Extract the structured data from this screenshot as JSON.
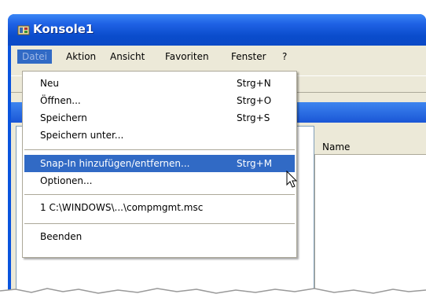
{
  "window": {
    "title": "Konsole1"
  },
  "menubar": {
    "items": [
      "Datei",
      "Aktion",
      "Ansicht",
      "Favoriten",
      "Fenster",
      "?"
    ]
  },
  "list_header": {
    "column": "Name"
  },
  "file_menu": {
    "group1": [
      {
        "label": "Neu",
        "shortcut": "Strg+N"
      },
      {
        "label": "Öffnen...",
        "shortcut": "Strg+O"
      },
      {
        "label": "Speichern",
        "shortcut": "Strg+S"
      },
      {
        "label": "Speichern unter...",
        "shortcut": ""
      }
    ],
    "group2": [
      {
        "label": "Snap-In hinzufügen/entfernen...",
        "shortcut": "Strg+M"
      },
      {
        "label": "Optionen...",
        "shortcut": ""
      }
    ],
    "recent": {
      "label": "1 C:\\WINDOWS\\...\\compmgmt.msc"
    },
    "exit": {
      "label": "Beenden"
    }
  },
  "colors": {
    "title_blue": "#0a54de",
    "highlight": "#316ac5",
    "menu_bg": "#ece9d8"
  }
}
